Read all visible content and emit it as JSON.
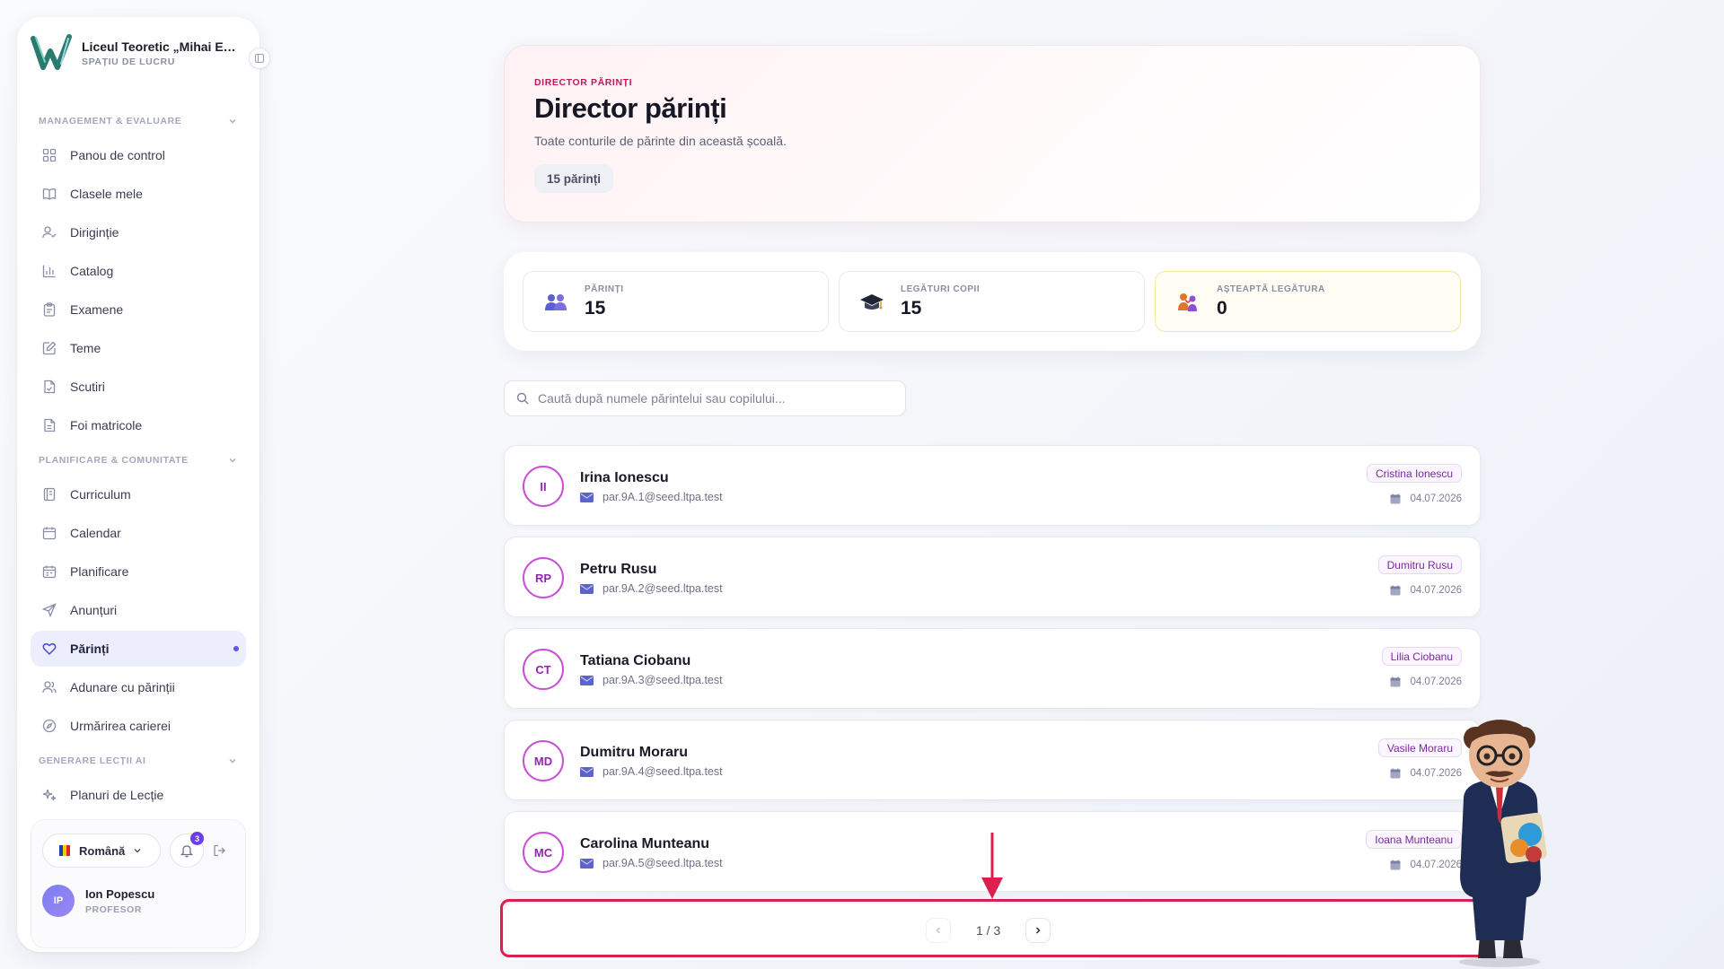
{
  "brand": {
    "name": "Liceul Teoretic „Mihai Emi...",
    "subtitle": "SPAȚIU DE LUCRU"
  },
  "nav": {
    "sections": [
      {
        "title": "MANAGEMENT & EVALUARE",
        "items": [
          {
            "label": "Panou de control",
            "icon": "grid-icon"
          },
          {
            "label": "Clasele mele",
            "icon": "book-icon"
          },
          {
            "label": "Diriginție",
            "icon": "user-check-icon"
          },
          {
            "label": "Catalog",
            "icon": "bar-chart-icon"
          },
          {
            "label": "Examene",
            "icon": "clipboard-icon"
          },
          {
            "label": "Teme",
            "icon": "edit-icon"
          },
          {
            "label": "Scutiri",
            "icon": "file-check-icon"
          },
          {
            "label": "Foi matricole",
            "icon": "file-text-icon"
          }
        ]
      },
      {
        "title": "PLANIFICARE & COMUNITATE",
        "items": [
          {
            "label": "Curriculum",
            "icon": "notebook-icon"
          },
          {
            "label": "Calendar",
            "icon": "calendar-icon"
          },
          {
            "label": "Planificare",
            "icon": "calendar-range-icon"
          },
          {
            "label": "Anunțuri",
            "icon": "send-icon"
          },
          {
            "label": "Părinți",
            "icon": "heart-icon",
            "active": true
          },
          {
            "label": "Adunare cu părinții",
            "icon": "users-icon"
          },
          {
            "label": "Urmărirea carierei",
            "icon": "compass-icon"
          }
        ]
      },
      {
        "title": "GENERARE LECȚII AI",
        "items": [
          {
            "label": "Planuri de Lecție",
            "icon": "sparkles-icon"
          }
        ]
      }
    ]
  },
  "footer": {
    "language": "Română",
    "notifications": "3",
    "user_initials": "IP",
    "user_name": "Ion Popescu",
    "user_role": "PROFESOR"
  },
  "hero": {
    "eyebrow": "DIRECTOR PĂRINȚI",
    "title": "Director părinți",
    "description": "Toate conturile de părinte din această școală.",
    "count_chip": "15 părinți"
  },
  "stats": [
    {
      "label": "PĂRINȚI",
      "value": "15",
      "icon": "parents-icon"
    },
    {
      "label": "LEGĂTURI COPII",
      "value": "15",
      "icon": "graduation-cap-icon"
    },
    {
      "label": "AȘTEAPTĂ LEGĂTURA",
      "value": "0",
      "icon": "family-icon"
    }
  ],
  "search": {
    "placeholder": "Caută după numele părintelui sau copilului...",
    "value": ""
  },
  "parents": [
    {
      "initials": "II",
      "name": "Irina Ionescu",
      "email": "par.9A.1@seed.ltpa.test",
      "child": "Cristina Ionescu",
      "date": "04.07.2026"
    },
    {
      "initials": "RP",
      "name": "Petru Rusu",
      "email": "par.9A.2@seed.ltpa.test",
      "child": "Dumitru Rusu",
      "date": "04.07.2026"
    },
    {
      "initials": "CT",
      "name": "Tatiana Ciobanu",
      "email": "par.9A.3@seed.ltpa.test",
      "child": "Lilia Ciobanu",
      "date": "04.07.2026"
    },
    {
      "initials": "MD",
      "name": "Dumitru Moraru",
      "email": "par.9A.4@seed.ltpa.test",
      "child": "Vasile Moraru",
      "date": "04.07.2026"
    },
    {
      "initials": "MC",
      "name": "Carolina Munteanu",
      "email": "par.9A.5@seed.ltpa.test",
      "child": "Ioana Munteanu",
      "date": "04.07.2026"
    }
  ],
  "pagination": {
    "text": "1 / 3"
  },
  "colors": {
    "accent": "#5a57e6",
    "eyebrow": "#c2185b",
    "highlight": "#dd1f4e",
    "avatar_ring": "#c94fd6"
  }
}
